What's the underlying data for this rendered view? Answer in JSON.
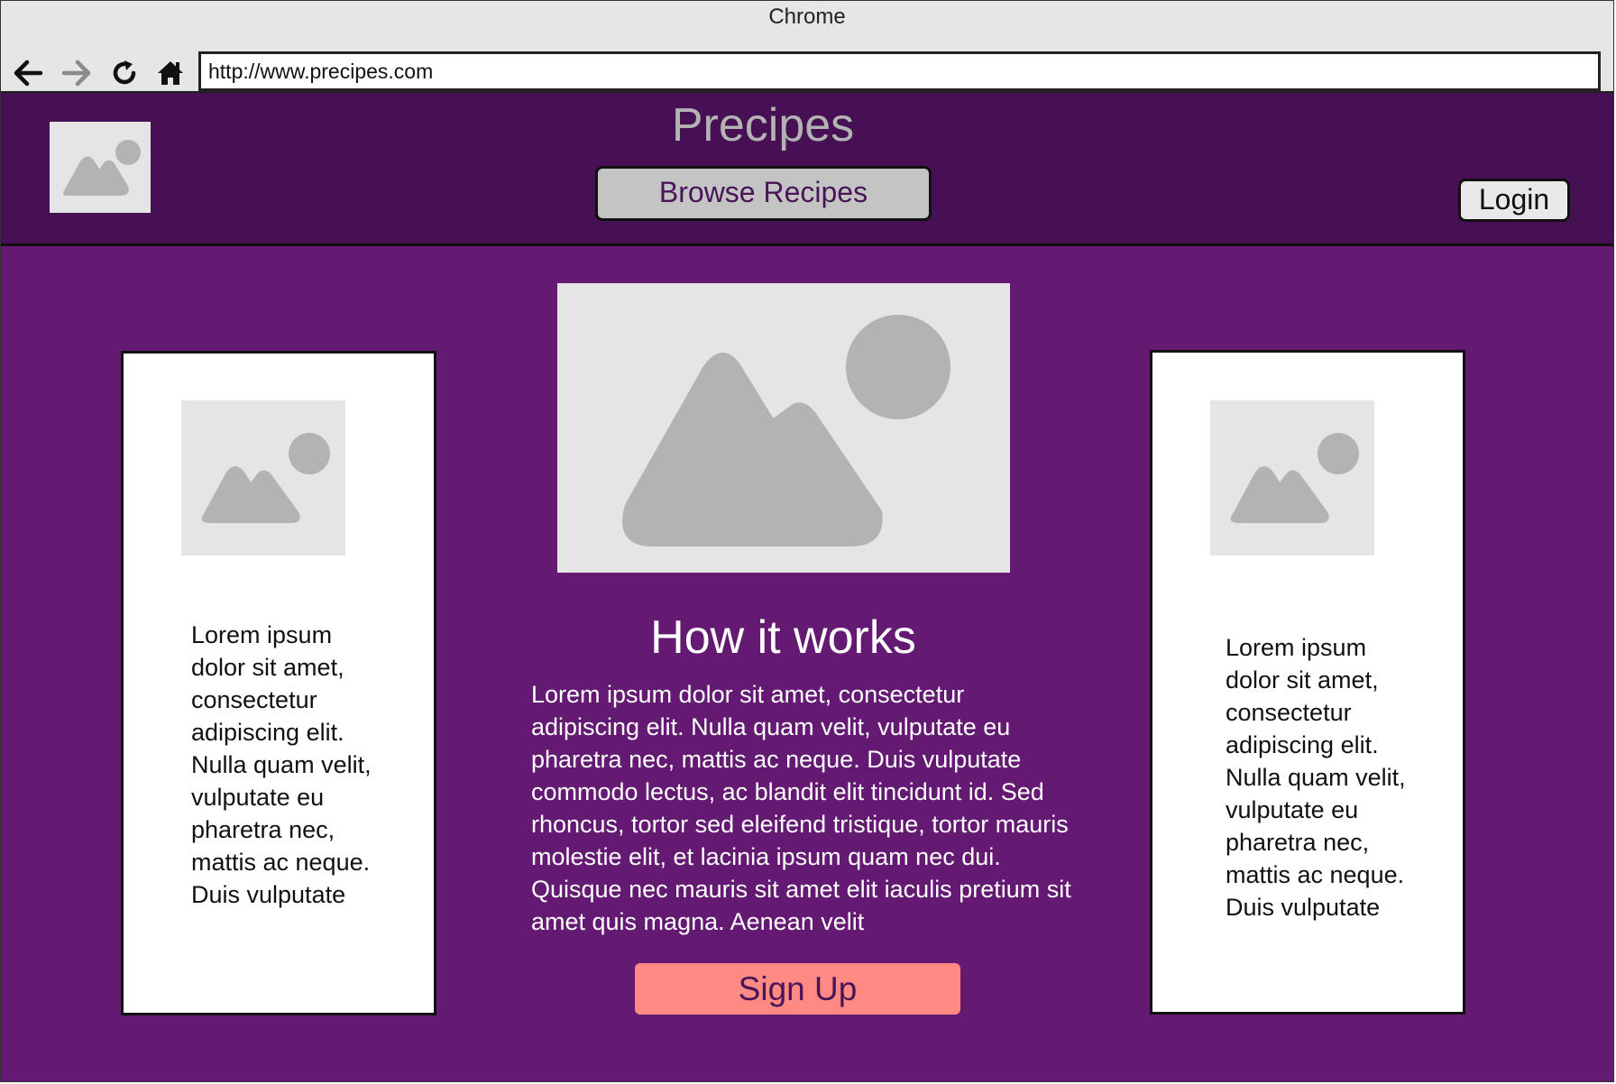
{
  "browser": {
    "title": "Chrome",
    "url": "http://www.precipes.com",
    "nav_icons": [
      "back-arrow-icon",
      "forward-arrow-icon",
      "reload-icon",
      "home-icon"
    ]
  },
  "header": {
    "site_title": "Precipes",
    "browse_label": "Browse Recipes",
    "login_label": "Login",
    "logo_icon": "image-placeholder-icon"
  },
  "left_card": {
    "image_icon": "image-placeholder-icon",
    "text": "Lorem ipsum dolor sit amet, consectetur adipiscing elit. Nulla quam velit, vulputate eu pharetra nec, mattis ac neque. Duis vulputate"
  },
  "center": {
    "hero_icon": "image-placeholder-icon",
    "heading": "How it works",
    "body": "Lorem ipsum dolor sit amet, consectetur adipiscing elit. Nulla quam velit, vulputate eu pharetra nec, mattis ac neque. Duis vulputate commodo lectus, ac blandit elit tincidunt id. Sed rhoncus, tortor sed eleifend tristique, tortor mauris molestie elit, et lacinia ipsum quam nec dui. Quisque nec mauris sit amet elit iaculis pretium sit amet quis magna. Aenean velit",
    "signup_label": "Sign Up"
  },
  "right_card": {
    "image_icon": "image-placeholder-icon",
    "text": "Lorem ipsum dolor sit amet, consectetur adipiscing elit. Nulla quam velit, vulputate eu pharetra nec, mattis ac neque. Duis vulputate"
  },
  "colors": {
    "page_bg": "#641a73",
    "header_bg": "#470f54",
    "placeholder_bg": "#e5e5e5",
    "placeholder_shape": "#b3b3b3",
    "signup_bg": "#ff8a84"
  }
}
